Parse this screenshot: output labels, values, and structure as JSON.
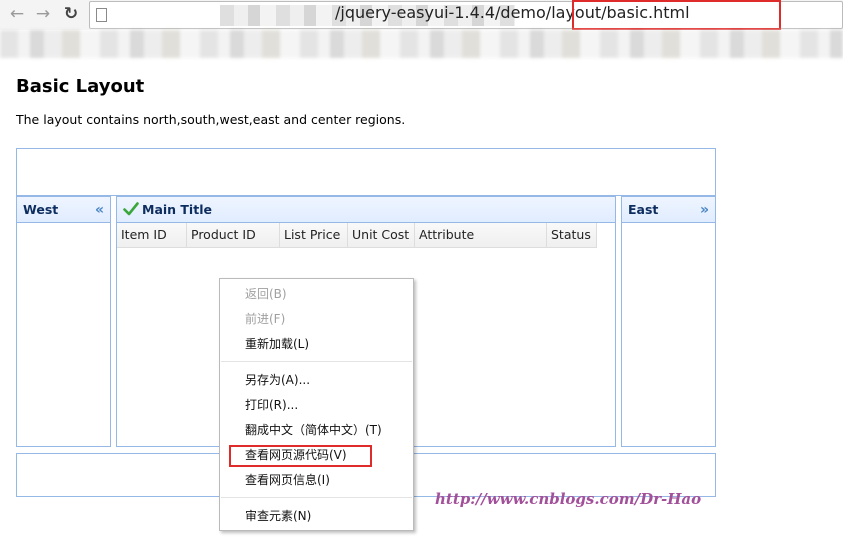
{
  "browser": {
    "url_visible": "/jquery-easyui-1.4.4/demo/layout/basic.html",
    "url_highlight_color": "#e02b2b"
  },
  "page": {
    "title": "Basic Layout",
    "description": "The layout contains north,south,west,east and center regions."
  },
  "layout": {
    "west_title": "West",
    "center_title": "Main Title",
    "east_title": "East",
    "collapse_west_glyph": "«",
    "collapse_east_glyph": "»",
    "border_color": "#95b8e7",
    "grid_columns": [
      "Item ID",
      "Product ID",
      "List Price",
      "Unit Cost",
      "Attribute",
      "Status"
    ]
  },
  "context_menu": {
    "items": [
      {
        "label": "返回(B)",
        "disabled": true
      },
      {
        "label": "前进(F)",
        "disabled": true
      },
      {
        "label": "重新加载(L)",
        "disabled": false
      },
      {
        "label": "另存为(A)...",
        "disabled": false
      },
      {
        "label": "打印(R)...",
        "disabled": false
      },
      {
        "label": "翻成中文（简体中文）(T)",
        "disabled": false
      },
      {
        "label": "查看网页源代码(V)",
        "disabled": false,
        "highlighted": true
      },
      {
        "label": "查看网页信息(I)",
        "disabled": false
      },
      {
        "label": "审查元素(N)",
        "disabled": false
      }
    ]
  },
  "watermark": "http://www.cnblogs.com/Dr-Hao",
  "icons": [
    "back-arrow-icon",
    "forward-arrow-icon",
    "reload-icon",
    "page-icon",
    "check-icon",
    "double-chevron-left-icon",
    "double-chevron-right-icon"
  ]
}
